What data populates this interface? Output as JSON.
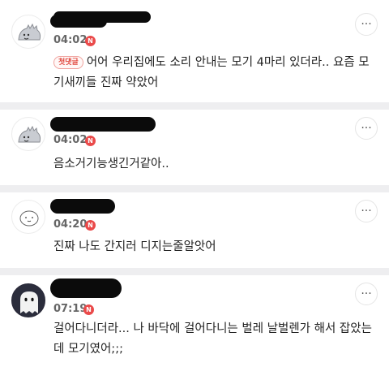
{
  "comments": [
    {
      "time": "04:02",
      "badge": "N",
      "tag": "첫댓글",
      "text": "어어 우리집에도 소리 안내는 모기 4마리 있더라.. 요즘 모기새끼들 진짜 약았어",
      "avatar_icon": "dinosaur-avatar-icon"
    },
    {
      "time": "04:02",
      "badge": "N",
      "text": "음소거기능생긴거같아..",
      "avatar_icon": "dinosaur-avatar-icon"
    },
    {
      "time": "04:20",
      "badge": "N",
      "text": "진짜 나도 간지러 디지는줄알앗어",
      "avatar_icon": "face-doodle-avatar-icon"
    },
    {
      "time": "07:19",
      "badge": "N",
      "text": "걸어다니더라... 나 바닥에 걸어다니는 벌레 날벌렌가 해서 잡았는데 모기였어;;;",
      "avatar_icon": "ghost-avatar-icon"
    }
  ],
  "more_button_label": "···",
  "colors": {
    "badge": "#ea4a4a",
    "separator": "#eeeef0",
    "tag": "#e0473e"
  }
}
